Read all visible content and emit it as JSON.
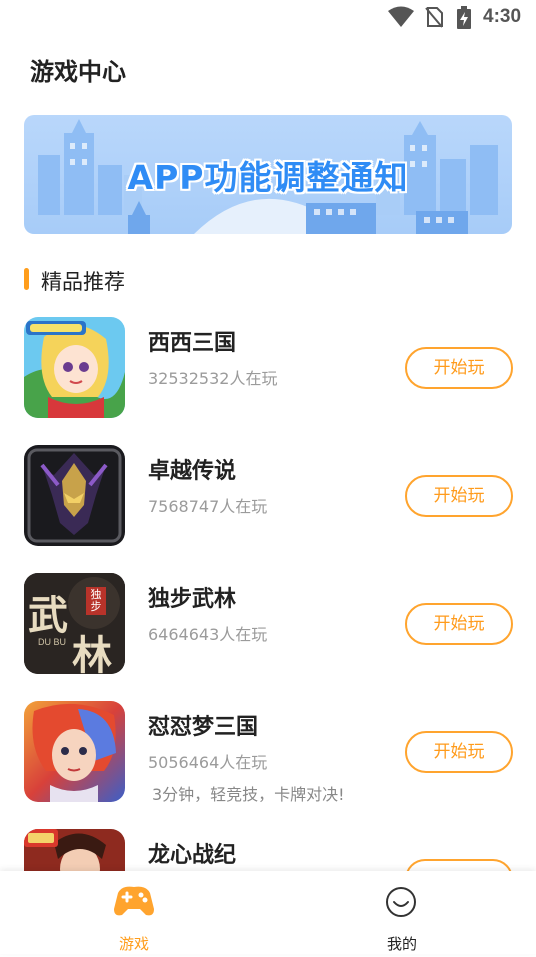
{
  "status_bar": {
    "time": "4:30",
    "icons": [
      "wifi-icon",
      "no-sim-icon",
      "battery-charging-icon"
    ]
  },
  "header": {
    "title": "游戏中心"
  },
  "banner": {
    "text": "APP功能调整通知"
  },
  "section": {
    "title": "精品推荐"
  },
  "games": [
    {
      "name": "西西三国",
      "players": "32532532人在玩",
      "desc": "",
      "button": "开始玩",
      "icon": "xixi-sanguo-icon"
    },
    {
      "name": "卓越传说",
      "players": "7568747人在玩",
      "desc": "",
      "button": "开始玩",
      "icon": "zhuoyue-chuanshuo-icon"
    },
    {
      "name": "独步武林",
      "players": "6464643人在玩",
      "desc": "",
      "button": "开始玩",
      "icon": "dubu-wulin-icon",
      "icon_text": [
        "武",
        "林",
        "独步",
        "DU BU"
      ]
    },
    {
      "name": "怼怼梦三国",
      "players": "5056464人在玩",
      "desc": "3分钟，轻竞技，卡牌对决!",
      "button": "开始玩",
      "icon": "duidui-meng-sanguo-icon"
    },
    {
      "name": "龙心战纪",
      "players": "",
      "desc": "",
      "button": "",
      "icon": "longxin-zhanji-icon"
    }
  ],
  "bottom_nav": [
    {
      "label": "游戏",
      "icon": "gamepad-icon",
      "active": true
    },
    {
      "label": "我的",
      "icon": "smiley-icon",
      "active": false
    }
  ],
  "colors": {
    "accent": "#ff9d1b",
    "banner_text": "#2f8cf5",
    "nav_active": "#ff9d1b",
    "nav_inactive": "#222222"
  }
}
